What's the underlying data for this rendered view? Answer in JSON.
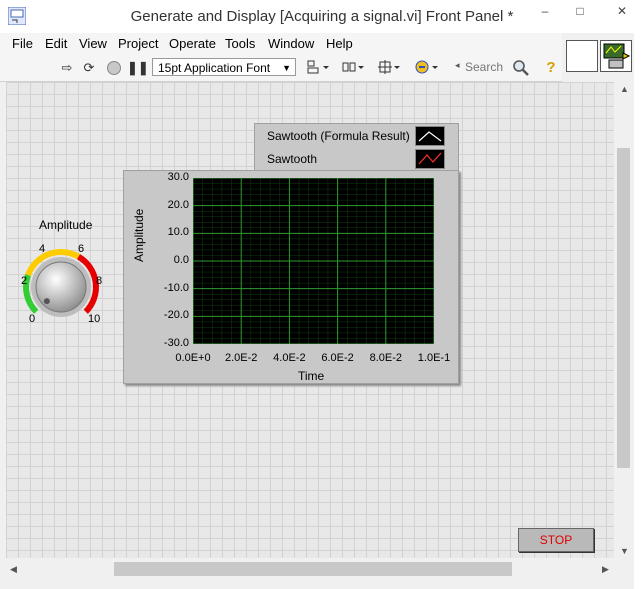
{
  "window": {
    "title": "Generate and Display [Acquiring a signal.vi] Front Panel *",
    "controls": {
      "minimize": "–",
      "maximize": "□",
      "close": "✕"
    }
  },
  "menu": {
    "items": [
      "File",
      "Edit",
      "View",
      "Project",
      "Operate",
      "Tools",
      "Window",
      "Help"
    ]
  },
  "toolbar": {
    "font": "15pt Application Font",
    "search_placeholder": "Search",
    "icons": [
      "run-arrow-icon",
      "run-continuously-icon",
      "abort-icon",
      "pause-icon",
      "align-icon",
      "distribute-icon",
      "resize-icon",
      "reorder-icon",
      "search-icon",
      "help-icon"
    ]
  },
  "knob": {
    "label": "Amplitude",
    "scale": [
      "0",
      "2",
      "4",
      "6",
      "8",
      "10"
    ],
    "value": 0,
    "colors": {
      "low": "#33cc33",
      "mid": "#ffcc00",
      "high": "#e60000"
    }
  },
  "legend": {
    "items": [
      {
        "name": "Sawtooth (Formula Result)",
        "color": "#ffffff"
      },
      {
        "name": "Sawtooth",
        "color": "#ff3333"
      }
    ]
  },
  "graph": {
    "y_ticks": [
      "30.0",
      "20.0",
      "10.0",
      "0.0",
      "-10.0",
      "-20.0",
      "-30.0"
    ],
    "x_ticks": [
      "0.0E+0",
      "2.0E-2",
      "4.0E-2",
      "6.0E-2",
      "8.0E-2",
      "1.0E-1"
    ],
    "ylabel": "Amplitude",
    "xlabel": "Time",
    "grid_color": "#1f6b1f",
    "background": "#000000"
  },
  "stop": {
    "label": "STOP"
  }
}
